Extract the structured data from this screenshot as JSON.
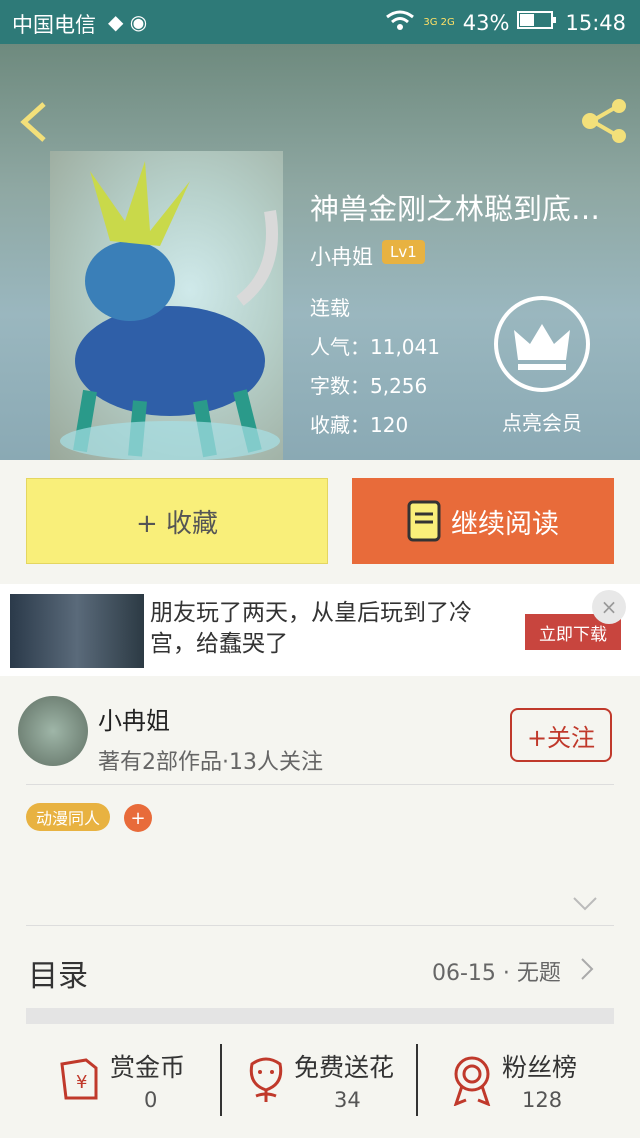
{
  "status_bar": {
    "carrier": "中国电信",
    "network": "3G 2G",
    "battery": "43%",
    "time": "15:48"
  },
  "book": {
    "title": "神兽金刚之林聪到底…",
    "author": "小冉姐",
    "author_level": "Lv1",
    "status": "连载",
    "popularity_label": "人气：",
    "popularity": "11,041",
    "words_label": "字数：",
    "words": "5,256",
    "favorites_label": "收藏：",
    "favorites": "120",
    "member_label": "点亮会员"
  },
  "actions": {
    "favorite_label": "+ 收藏",
    "read_label": "继续阅读"
  },
  "ad": {
    "text": "朋友玩了两天，从皇后玩到了冷宫，给蠢哭了",
    "button": "立即下载",
    "close": "×"
  },
  "author_section": {
    "name": "小冉姐",
    "info": "著有2部作品·13人关注",
    "follow_label": "+关注",
    "tag": "动漫同人",
    "tag_add": "+"
  },
  "toc": {
    "label": "目录",
    "latest": "06-15 · 无题"
  },
  "bottom_stats": [
    {
      "label": "赏金币",
      "value": "0",
      "icon": "red-envelope-icon"
    },
    {
      "label": "免费送花",
      "value": "34",
      "icon": "flower-icon"
    },
    {
      "label": "粉丝榜",
      "value": "128",
      "icon": "medal-icon"
    }
  ],
  "colors": {
    "accent_orange": "#e86b3a",
    "accent_yellow": "#f9ef7a",
    "level_badge": "#e8b241",
    "follow_red": "#c0392b",
    "status_bar": "#2e7a78"
  }
}
